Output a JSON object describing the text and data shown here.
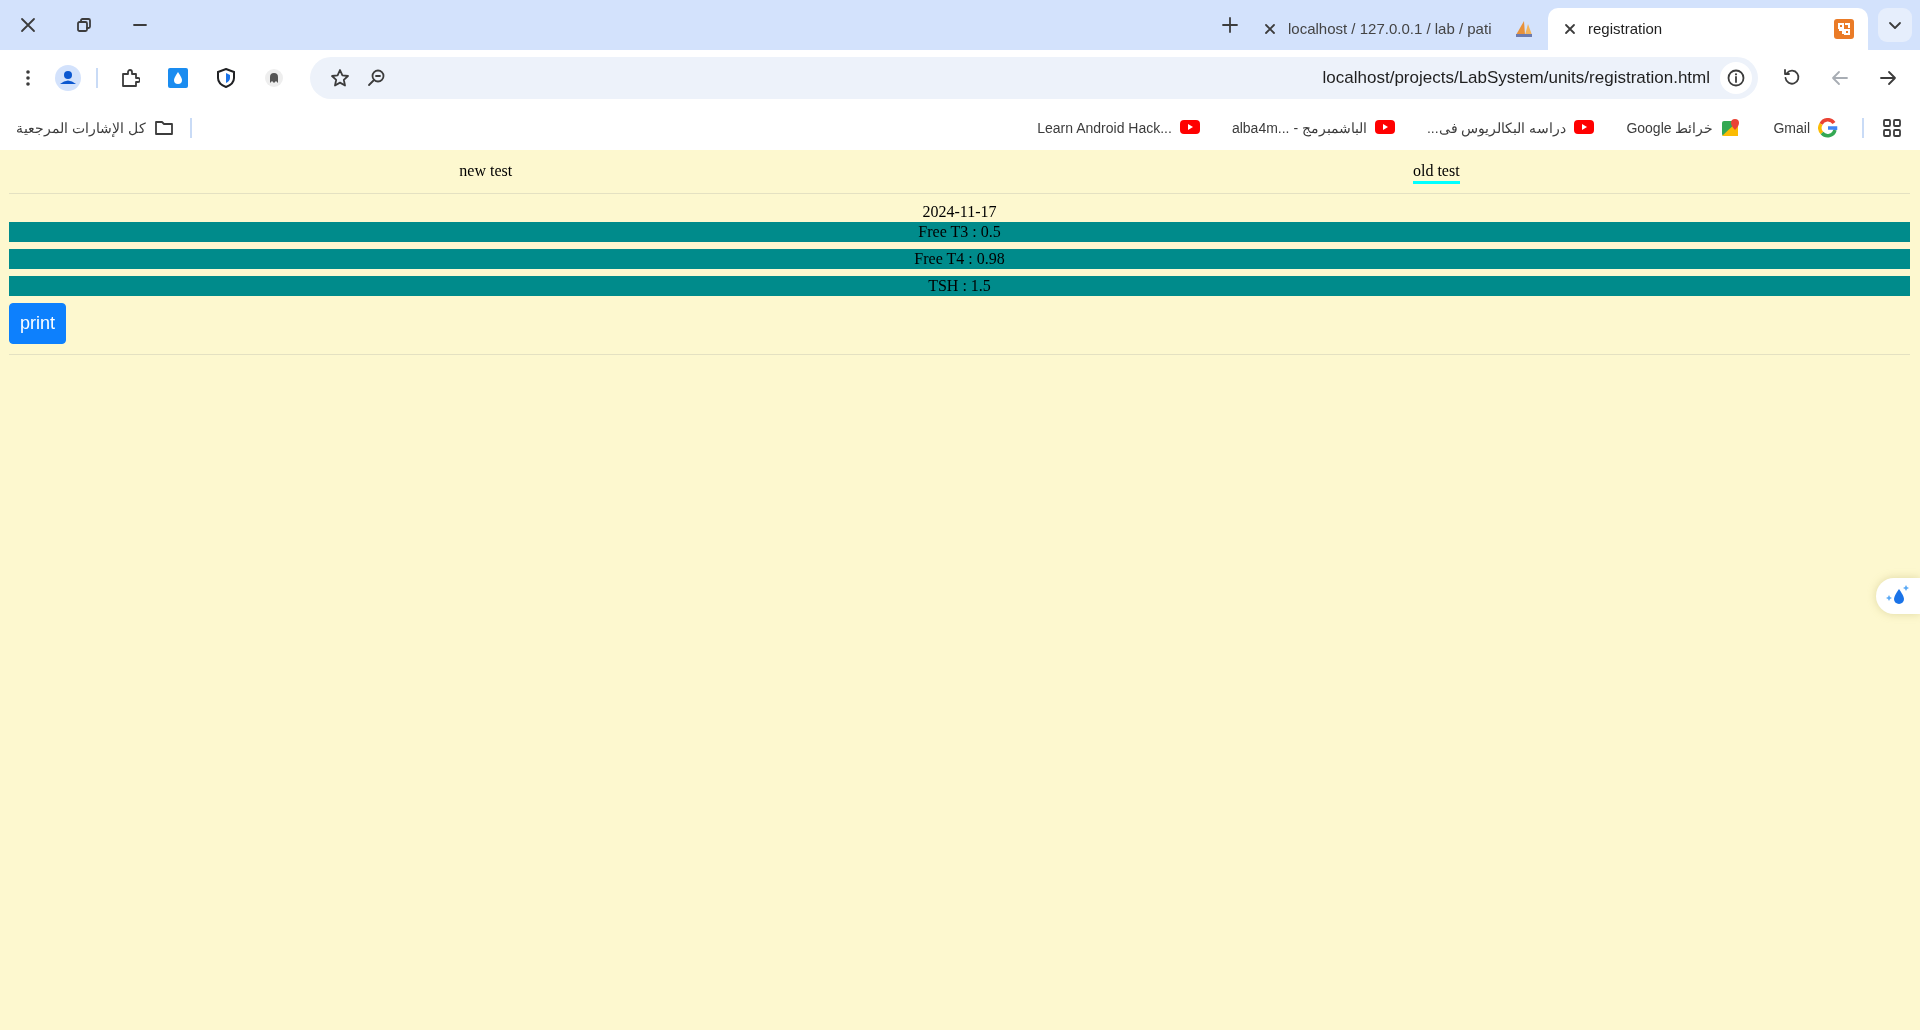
{
  "browser": {
    "tabs": [
      {
        "title": "localhost / 127.0.0.1 / lab / pati",
        "kind": "sail",
        "selected": false
      },
      {
        "title": "registration",
        "kind": "square",
        "selected": true
      }
    ],
    "address_bar": {
      "url": "localhost/projects/LabSystem/units/registration.html"
    },
    "nav_buttons": [
      {
        "kind": "forward",
        "disabled": true
      },
      {
        "kind": "back",
        "disabled": false
      }
    ],
    "all_bookmarks": "كل الإشارات المرجعية",
    "bookmarks": [
      {
        "label": "Learn Android Hack...",
        "kind": "video"
      },
      {
        "label": "alba4m... - الباشمبرمج",
        "kind": "video"
      },
      {
        "label": "دراسه البكالريوس فى...",
        "kind": "video"
      },
      {
        "label": "خرائط Google",
        "kind": "map"
      },
      {
        "label": "Gmail",
        "kind": "g"
      }
    ]
  },
  "page": {
    "tabs": [
      {
        "label": "new test",
        "selected": false
      },
      {
        "label": "old test",
        "selected": true
      }
    ],
    "date": "2024-11-17",
    "results": [
      "Free T3 : 0.5",
      "Free T4 : 0.98",
      "TSH : 1.5"
    ],
    "print_button": "print"
  }
}
